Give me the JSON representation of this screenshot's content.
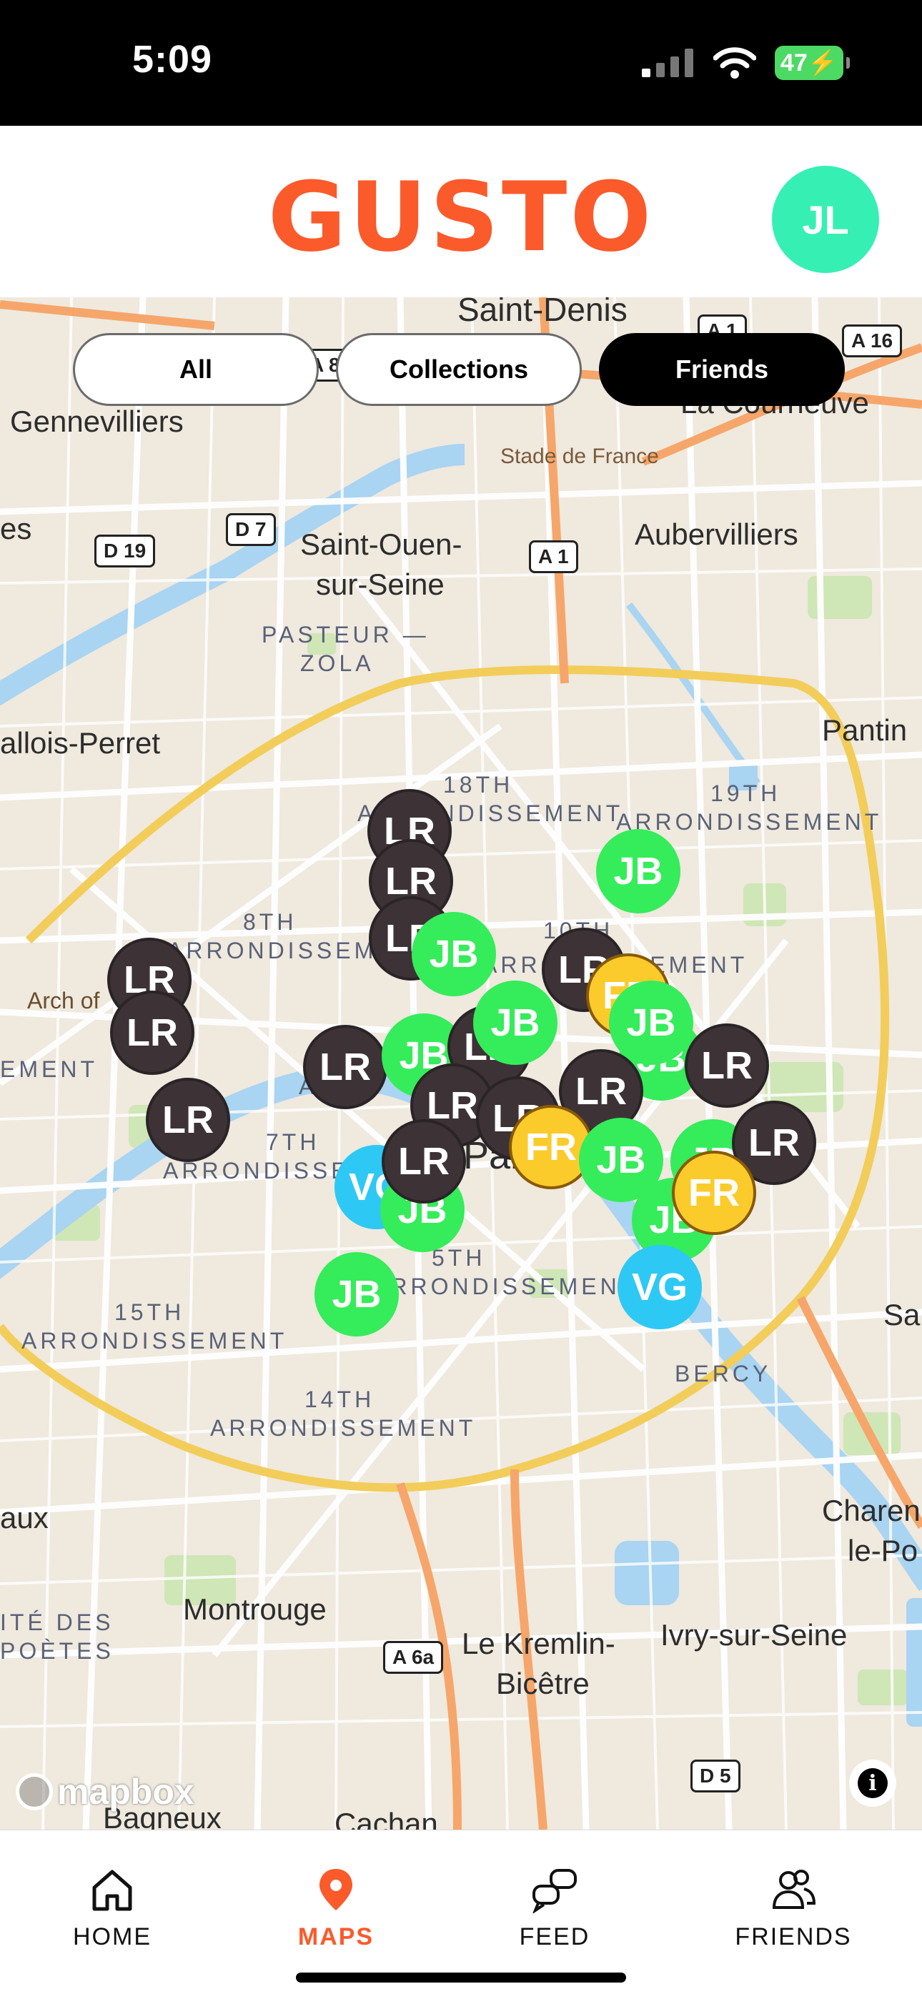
{
  "status_bar": {
    "time": "5:09",
    "battery": "47"
  },
  "header": {
    "logo": "GUSTO",
    "avatar_initials": "JL"
  },
  "filters": [
    {
      "label": "All",
      "active": false
    },
    {
      "label": "Collections",
      "active": false
    },
    {
      "label": "Friends",
      "active": true
    }
  ],
  "map": {
    "place_labels": [
      "Saint-Denis",
      "La Courneuve",
      "Gennevilliers",
      "Stade de France",
      "Aubervilliers",
      "Saint-Ouen-",
      "sur-Seine",
      "PASTEUR —",
      "ZOLA",
      "Pantin",
      "allois-Perret",
      "18TH",
      "ARRONDISSEMENT",
      "19TH",
      "ARRONDISSEMENT",
      "8TH",
      "ARRONDISSEMENT",
      "10TH",
      "ARRONDISSEMENT",
      "Arch of",
      "7TH",
      "ARRONDISSEMENT",
      "5TH",
      "ARRONDISSEMENT",
      "15TH",
      "ARRONDISSEMENT",
      "14TH",
      "ARRONDISSEMENT",
      "BERCY",
      "Montrouge",
      "Le Kremlin-",
      "Bicêtre",
      "Ivry-sur-Seine",
      "Charen",
      "le-Po",
      "ITÉ DES",
      "POÈTES",
      "Bagneux",
      "Cachan",
      "es",
      "Sa",
      "aux",
      "Paris",
      "EMENT",
      "ARR"
    ],
    "road_shields": [
      "A 16",
      "A 1",
      "A 86",
      "D 7",
      "D 19",
      "A 1",
      "A 6a",
      "D 5"
    ],
    "pins": [
      {
        "initials": "LR",
        "type": "lr"
      },
      {
        "initials": "LR",
        "type": "lr"
      },
      {
        "initials": "LR",
        "type": "lr"
      },
      {
        "initials": "JB",
        "type": "jb"
      },
      {
        "initials": "JB",
        "type": "jb"
      },
      {
        "initials": "LR",
        "type": "lr"
      },
      {
        "initials": "LR",
        "type": "lr"
      },
      {
        "initials": "LR",
        "type": "lr"
      },
      {
        "initials": "LR",
        "type": "lr"
      },
      {
        "initials": "JB",
        "type": "jb"
      },
      {
        "initials": "LR",
        "type": "lr"
      },
      {
        "initials": "JB",
        "type": "jb"
      },
      {
        "initials": "LR",
        "type": "lr"
      },
      {
        "initials": "FR",
        "type": "fr"
      },
      {
        "initials": "JB",
        "type": "jb"
      },
      {
        "initials": "JB",
        "type": "jb"
      },
      {
        "initials": "LR",
        "type": "lr"
      },
      {
        "initials": "LR",
        "type": "lr"
      },
      {
        "initials": "LR",
        "type": "lr"
      },
      {
        "initials": "LR",
        "type": "lr"
      },
      {
        "initials": "FR",
        "type": "fr"
      },
      {
        "initials": "JB",
        "type": "jb"
      },
      {
        "initials": "JB",
        "type": "jb"
      },
      {
        "initials": "LR",
        "type": "lr"
      },
      {
        "initials": "VG",
        "type": "vg"
      },
      {
        "initials": "JB",
        "type": "jb"
      },
      {
        "initials": "LR",
        "type": "lr"
      },
      {
        "initials": "JB",
        "type": "jb"
      },
      {
        "initials": "FR",
        "type": "fr"
      },
      {
        "initials": "VG",
        "type": "vg"
      },
      {
        "initials": "JB",
        "type": "jb"
      }
    ],
    "attribution": "mapbox",
    "info_icon": "i"
  },
  "tabs": [
    {
      "label": "HOME",
      "icon": "home-icon",
      "active": false
    },
    {
      "label": "MAPS",
      "icon": "map-pin-icon",
      "active": true
    },
    {
      "label": "FEED",
      "icon": "chat-bubbles-icon",
      "active": false
    },
    {
      "label": "FRIENDS",
      "icon": "friends-icon",
      "active": false
    }
  ],
  "colors": {
    "brand": "#fb5a2b",
    "avatar": "#35f0b2",
    "lr": "#3d3337",
    "jb": "#35ec5a",
    "vg": "#2ec8f4",
    "fr": "#fbcb2c"
  }
}
